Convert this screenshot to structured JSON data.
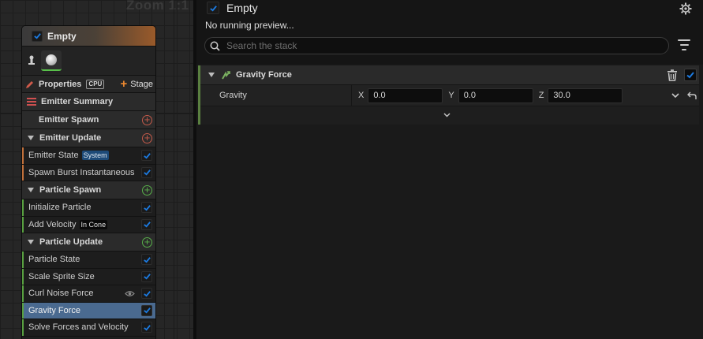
{
  "graph": {
    "zoom_label": "Zoom 1:1"
  },
  "emitter_node": {
    "title": "Empty",
    "enabled": true,
    "properties_label": "Properties",
    "sim_target_badge": "CPU",
    "stage_button_label": "Stage",
    "sections": [
      {
        "label": "Emitter Summary",
        "type": "summary"
      },
      {
        "label": "Emitter Spawn",
        "type": "stage",
        "add_color": "red",
        "expanded": false
      },
      {
        "label": "Emitter Update",
        "type": "stage",
        "add_color": "red",
        "expanded": true,
        "modules": [
          {
            "label": "Emitter State",
            "tag": "System",
            "enabled": true
          },
          {
            "label": "Spawn Burst Instantaneous",
            "enabled": true
          }
        ]
      },
      {
        "label": "Particle Spawn",
        "type": "stage",
        "add_color": "green",
        "expanded": true,
        "modules": [
          {
            "label": "Initialize Particle",
            "enabled": true
          },
          {
            "label": "Add Velocity",
            "tag": "In Cone",
            "enabled": true
          }
        ]
      },
      {
        "label": "Particle Update",
        "type": "stage",
        "add_color": "green",
        "expanded": true,
        "modules": [
          {
            "label": "Particle State",
            "enabled": true
          },
          {
            "label": "Scale Sprite Size",
            "enabled": true
          },
          {
            "label": "Curl Noise Force",
            "enabled": true,
            "has_visibility_icon": true
          },
          {
            "label": "Gravity Force",
            "enabled": true,
            "selected": true
          },
          {
            "label": "Solve Forces and Velocity",
            "enabled": true
          }
        ]
      }
    ]
  },
  "panel": {
    "title": "Empty",
    "enabled": true,
    "preview_status": "No running preview...",
    "search_placeholder": "Search the stack",
    "module": {
      "title": "Gravity Force",
      "enabled": true,
      "params": [
        {
          "label": "Gravity",
          "x_label": "X",
          "x": "0.0",
          "y_label": "Y",
          "y": "0.0",
          "z_label": "Z",
          "z": "30.0"
        }
      ]
    }
  },
  "colors": {
    "accent_blue": "#1c7ae0",
    "selected_row": "#4a6a90",
    "stage_orange": "#f08a30",
    "green": "#58b04a"
  }
}
